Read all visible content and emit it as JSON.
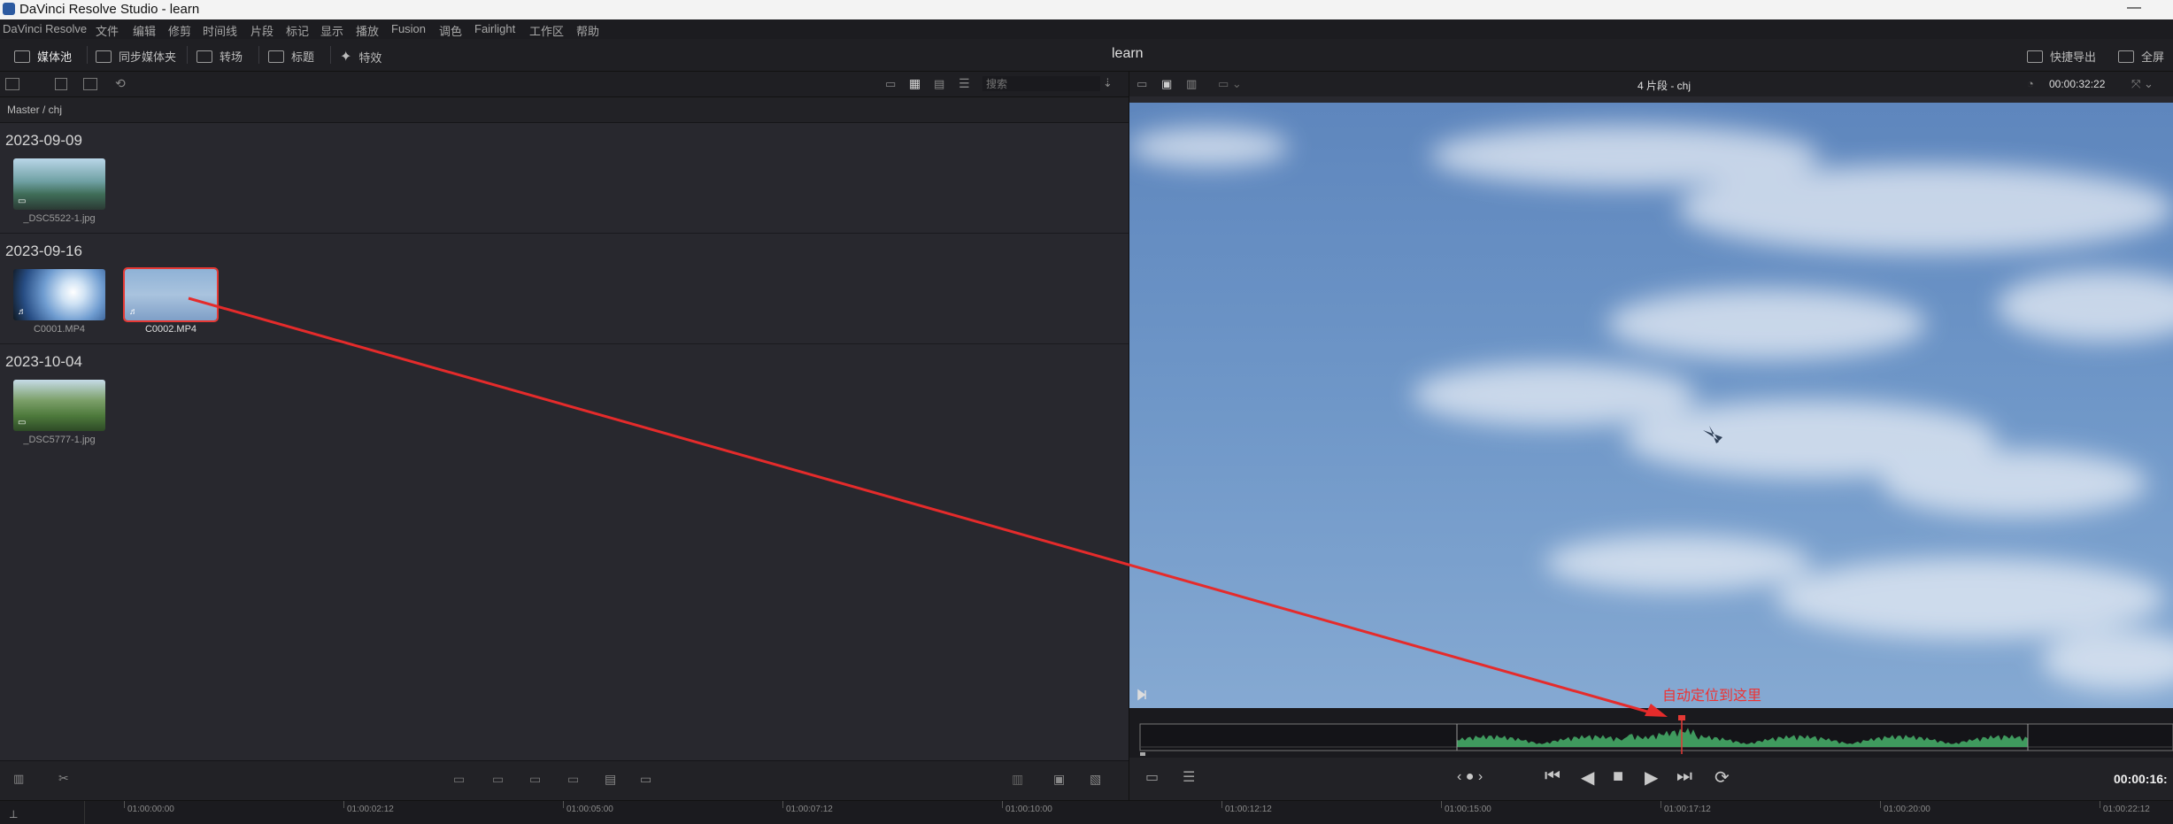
{
  "window": {
    "title": "DaVinci Resolve Studio - learn",
    "minimize": "—"
  },
  "menu": [
    "DaVinci Resolve",
    "文件",
    "编辑",
    "修剪",
    "时间线",
    "片段",
    "标记",
    "显示",
    "播放",
    "Fusion",
    "调色",
    "Fairlight",
    "工作区",
    "帮助"
  ],
  "toolbar": {
    "media_pool": "媒体池",
    "sync_bin": "同步媒体夹",
    "transitions": "转场",
    "titles": "标题",
    "effects": "特效",
    "project_name": "learn",
    "quick_export": "快捷导出",
    "fullscreen": "全屏"
  },
  "pool": {
    "search_placeholder": "搜索",
    "path": "Master / chj",
    "groups": [
      {
        "date": "2023-09-09",
        "clips": [
          {
            "name": "_DSC5522-1.jpg",
            "type": "image"
          }
        ]
      },
      {
        "date": "2023-09-16",
        "clips": [
          {
            "name": "C0001.MP4",
            "type": "video-audio"
          },
          {
            "name": "C0002.MP4",
            "type": "video-audio",
            "selected": true
          }
        ]
      },
      {
        "date": "2023-10-04",
        "clips": [
          {
            "name": "_DSC5777-1.jpg",
            "type": "image"
          }
        ]
      }
    ]
  },
  "viewer": {
    "title": "4 片段 - chj",
    "duration": "00:00:32:22",
    "timecode": "00:00:16:"
  },
  "annotation": {
    "text": "自动定位到这里",
    "color": "#e52b2b"
  },
  "ruler": {
    "ticks": [
      "01:00:00:00",
      "01:00:02:12",
      "01:00:05:00",
      "01:00:07:12",
      "01:00:10:00",
      "01:00:12:12",
      "01:00:15:00",
      "01:00:17:12",
      "01:00:20:00",
      "01:00:22:12"
    ]
  },
  "colors": {
    "accent_waveform": "#3f9a5e",
    "playhead": "#e53935",
    "selection": "#e53935"
  }
}
